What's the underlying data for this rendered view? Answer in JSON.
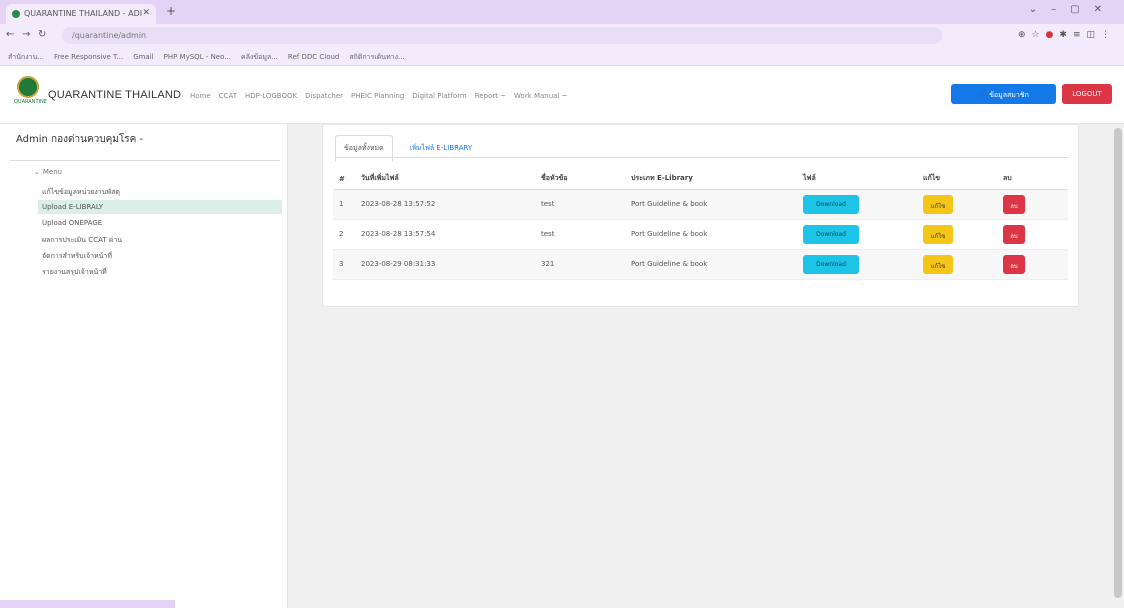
{
  "browser": {
    "tab_title": "QUARANTINE THAILAND - ADI",
    "url": "/quarantine/admin",
    "bookmarks": [
      "สำนักงาน...",
      "Free Responsive T...",
      "Gmail",
      "PHP MySQL - Neo...",
      "คลังข้อมูล...",
      "Ref DDC Cloud",
      "สถิติการเดินทาง..."
    ]
  },
  "header": {
    "logo_text": "QUARANTINE",
    "brand": "QUARANTINE THAILAND",
    "nav": [
      "Home",
      "CCAT",
      "HDP-LOGBOOK",
      "Dispatcher",
      "PHEIC Planning",
      "Digital Platform",
      "Report ~",
      "Work Manual ~"
    ],
    "user_button": "ข้อมูลสมาชิก",
    "logout": "LOGOUT"
  },
  "sidebar": {
    "title": "Admin กองด่านควบคุมโรค -",
    "menu_label": "Menu",
    "items": [
      {
        "label": "แก้ไขข้อมูลหน่วยงานพัสดุ",
        "active": false
      },
      {
        "label": "Upload E-LIBRALY",
        "active": true
      },
      {
        "label": "Upload ONEPAGE",
        "active": false
      },
      {
        "label": "ผลการประเมิน CCAT ด่าน",
        "active": false
      },
      {
        "label": "จัดการสำหรับเจ้าหน้าที่",
        "active": false
      },
      {
        "label": "รายงานสรุปเจ้าหน้าที่",
        "active": false
      }
    ]
  },
  "main": {
    "tabs": [
      "ข้อมูลทั้งหมด",
      "เพิ่มไฟล์ E-LIBRARY"
    ],
    "columns": [
      "#",
      "วันที่เพิ่มไฟล์",
      "ชื่อหัวข้อ",
      "ประเภท E-Library",
      "ไฟล์",
      "แก้ไข",
      "ลบ"
    ],
    "rows": [
      {
        "no": "1",
        "date": "2023-08-28 13:57:52",
        "title": "test",
        "type": "Port Guideline & book",
        "download": "Download",
        "edit": "แก้ไข",
        "delete": "ลบ"
      },
      {
        "no": "2",
        "date": "2023-08-28 13:57:54",
        "title": "test",
        "type": "Port Guideline & book",
        "download": "Download",
        "edit": "แก้ไข",
        "delete": "ลบ"
      },
      {
        "no": "3",
        "date": "2023-08-29 08:31:33",
        "title": "321",
        "type": "Port Guideline & book",
        "download": "Download",
        "edit": "แก้ไข",
        "delete": "ลบ"
      }
    ]
  },
  "colors": {
    "primary": "#1479e8",
    "danger": "#dc3545",
    "info": "#1dc4e8",
    "warning": "#f5c518",
    "active_menu_bg": "#dbefe6"
  }
}
